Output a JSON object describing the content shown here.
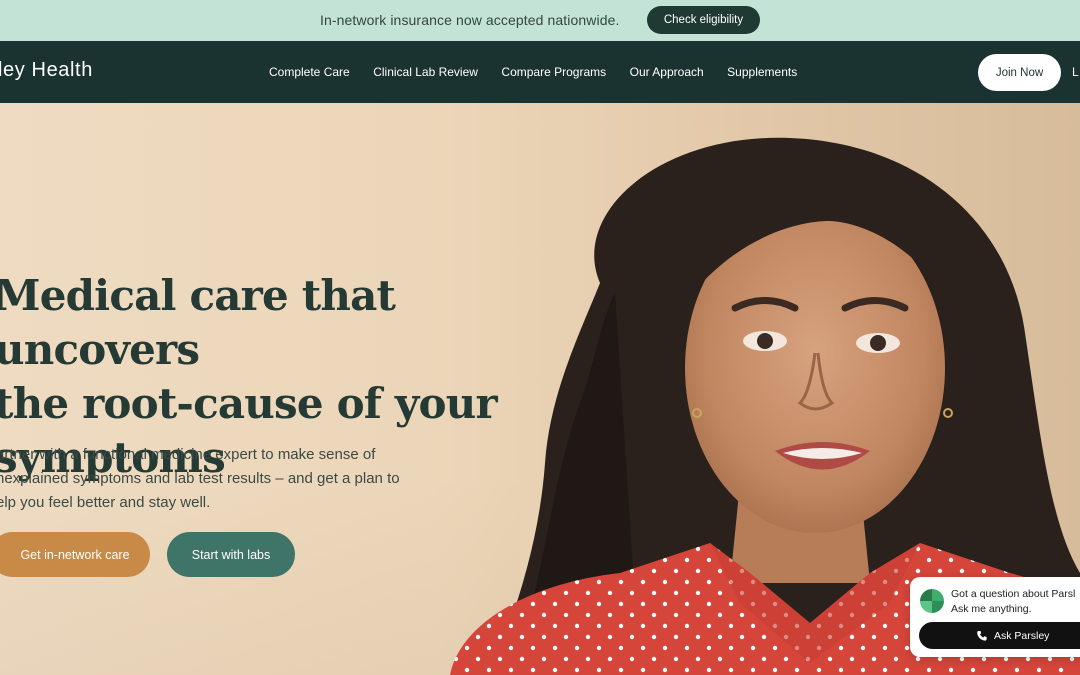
{
  "banner": {
    "text": "In-network insurance now accepted nationwide.",
    "button_label": "Check eligibility"
  },
  "header": {
    "logo_text": "ley Health",
    "nav_items": [
      {
        "label": "Complete Care"
      },
      {
        "label": "Clinical Lab Review"
      },
      {
        "label": "Compare Programs"
      },
      {
        "label": "Our Approach"
      },
      {
        "label": "Supplements"
      }
    ],
    "join_label": "Join Now",
    "login_cut": "L"
  },
  "hero": {
    "headline_lines": [
      "Medical care that uncovers",
      "the root-cause of your",
      "symptoms"
    ],
    "subcopy_lines": [
      "artner with a functional medicine expert to make sense of",
      "nexplained symptoms and lab test results – and get a plan to",
      "elp you feel better and stay well."
    ],
    "primary_cta": "Get in-network care",
    "secondary_cta": "Start with labs"
  },
  "chat": {
    "line1": "Got a question about Parsl",
    "line2": "Ask me anything.",
    "button_label": "Ask Parsley",
    "icons": {
      "logo": "parsley-logo-icon",
      "phone": "phone-icon"
    }
  },
  "colors": {
    "banner_bg": "#c2e3d6",
    "header_bg": "#1b3330",
    "primary_cta": "#c88a46",
    "secondary_cta": "#3f7568",
    "shirt_red": "#d6453a"
  }
}
